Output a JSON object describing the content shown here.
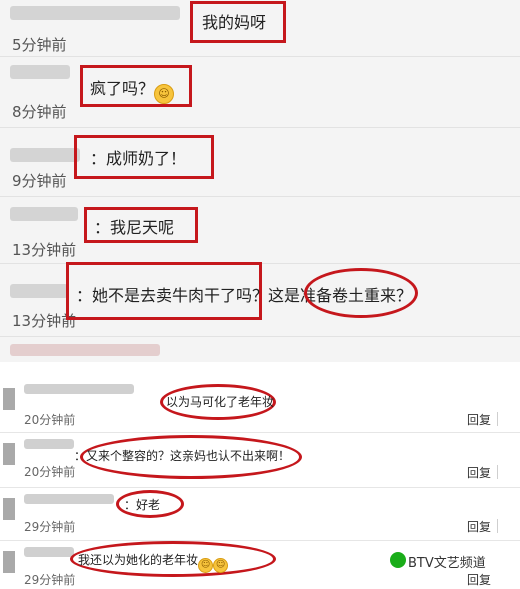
{
  "top_comments": [
    {
      "time": "5分钟前",
      "text": "我的妈呀"
    },
    {
      "time": "8分钟前",
      "text": "疯了吗？",
      "emoji": "shrug-emoji"
    },
    {
      "time": "9分钟前",
      "text": "：成师奶了！"
    },
    {
      "time": "13分钟前",
      "text": "：我尼天呢"
    },
    {
      "time": "13分钟前",
      "text": "：她不是去卖牛肉干了吗？这是准备卷土重来？"
    }
  ],
  "bottom_comments": [
    {
      "time": "20分钟前",
      "text": "以为马可化了老年妆",
      "reply": "回复"
    },
    {
      "time": "20分钟前",
      "text": "：又来个整容的？这亲妈也认不出来啊！",
      "reply": "回复"
    },
    {
      "time": "29分钟前",
      "text": "：好老",
      "reply": "回复"
    },
    {
      "time": "29分钟前",
      "text": "我还以为她化的老年妆",
      "reply": "回复",
      "emoji": "laugh-cry-emoji"
    }
  ],
  "watermark": "BTV文艺频道",
  "colors": {
    "highlight": "#c5171c"
  }
}
